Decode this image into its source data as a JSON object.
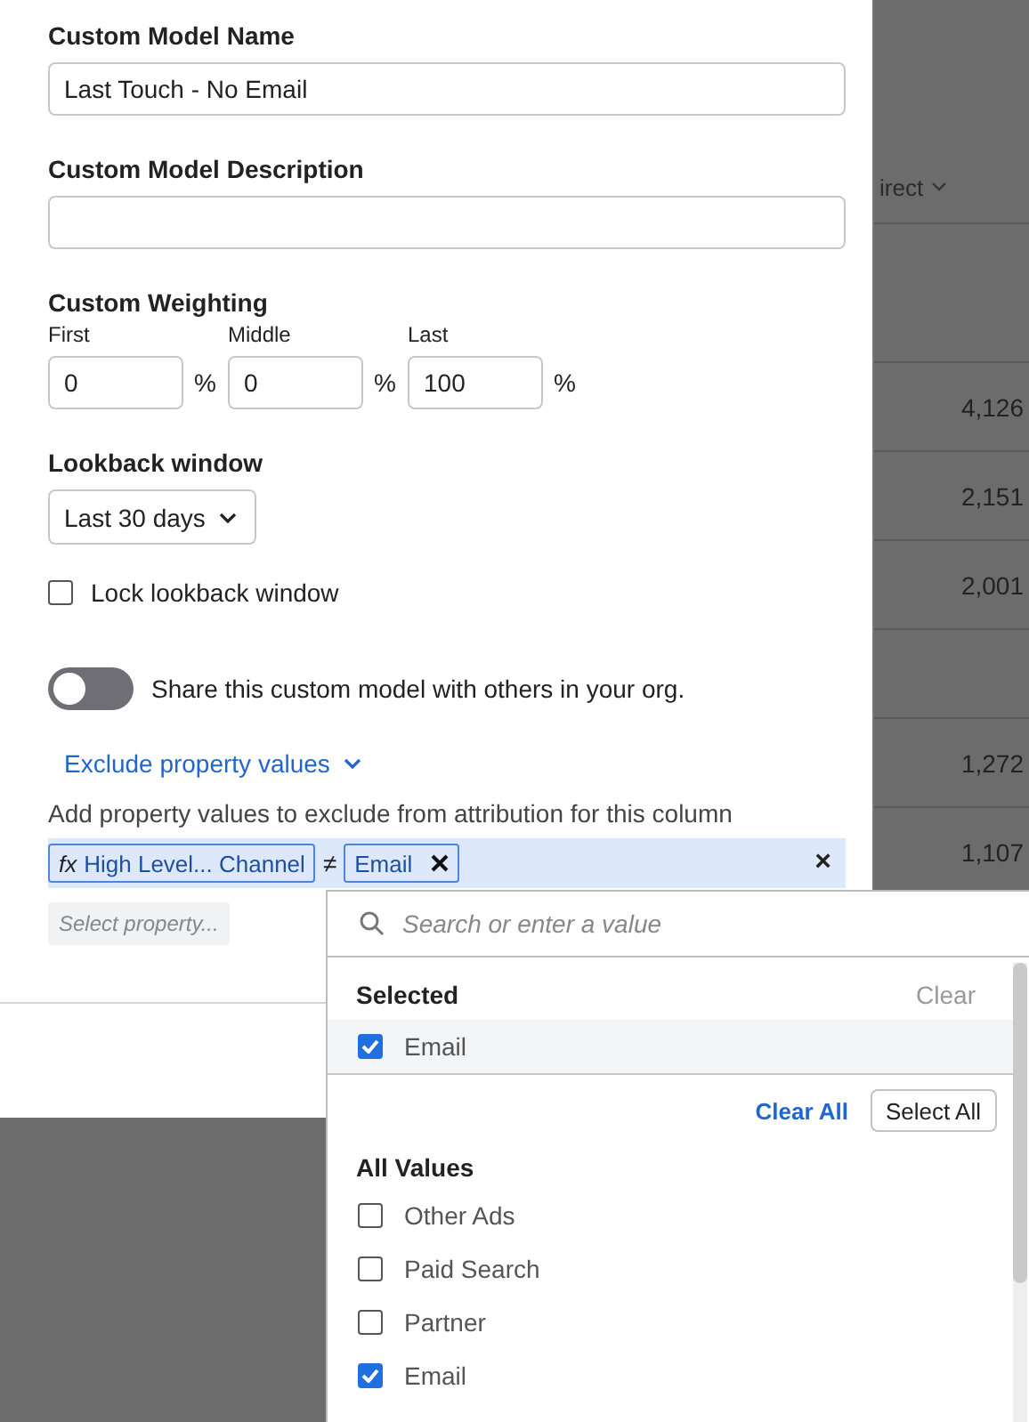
{
  "background_table": {
    "column_header": "irect",
    "rows": [
      {
        "value": "4,126"
      },
      {
        "value": "2,151"
      },
      {
        "value": "2,001"
      },
      {},
      {
        "value": "1,272"
      },
      {
        "value": "1,107"
      }
    ]
  },
  "form": {
    "name_label": "Custom Model Name",
    "name_value": "Last Touch - No Email",
    "description_label": "Custom Model Description",
    "weighting_label": "Custom Weighting",
    "weights": [
      {
        "label": "First",
        "value": "0",
        "unit": "%"
      },
      {
        "label": "Middle",
        "value": "0",
        "unit": "%"
      },
      {
        "label": "Last",
        "value": "100",
        "unit": "%"
      }
    ],
    "lookback_label": "Lookback window",
    "lookback_value": "Last 30 days",
    "lock": {
      "label": "Lock lookback window",
      "checked": false
    },
    "share": {
      "label": "Share this custom model with others in your org.",
      "on": false
    },
    "exclude_link": "Exclude property values",
    "exclude_help": "Add property values to exclude from attribution for this column",
    "filter": {
      "fx": "fx",
      "property": "High Level... Channel",
      "operator": "≠",
      "value": "Email",
      "remove": "×"
    },
    "select_property_placeholder": "Select property..."
  },
  "dropdown": {
    "search_placeholder": "Search or enter a value",
    "selected_heading": "Selected",
    "clear": "Clear",
    "selected_items": [
      {
        "label": "Email",
        "checked": true
      }
    ],
    "clear_all": "Clear All",
    "select_all": "Select All",
    "all_heading": "All Values",
    "values": [
      {
        "label": "Other Ads",
        "checked": false
      },
      {
        "label": "Paid Search",
        "checked": false
      },
      {
        "label": "Partner",
        "checked": false
      },
      {
        "label": "Email",
        "checked": true
      }
    ]
  }
}
